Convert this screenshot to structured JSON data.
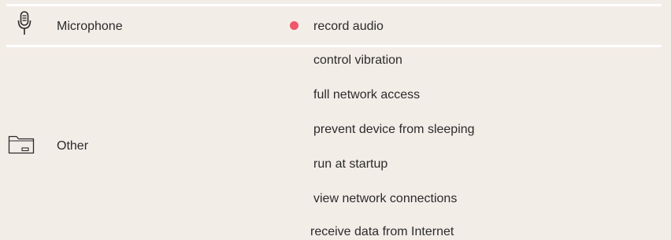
{
  "colors": {
    "background": "#f3ede8",
    "divider": "#ffffff",
    "text": "#2b2b2b",
    "risk_dot": "#f0566a"
  },
  "groups": [
    {
      "icon": "microphone-icon",
      "label": "Microphone",
      "permissions": [
        {
          "label": "record audio",
          "flagged": true
        }
      ]
    },
    {
      "icon": "folder-icon",
      "label": "Other",
      "permissions": [
        {
          "label": "control vibration",
          "flagged": false
        },
        {
          "label": "full network access",
          "flagged": false
        },
        {
          "label": "prevent device from sleeping",
          "flagged": false
        },
        {
          "label": "run at startup",
          "flagged": false
        },
        {
          "label": "view network connections",
          "flagged": false
        },
        {
          "label": "receive data from Internet",
          "flagged": false
        }
      ]
    }
  ]
}
